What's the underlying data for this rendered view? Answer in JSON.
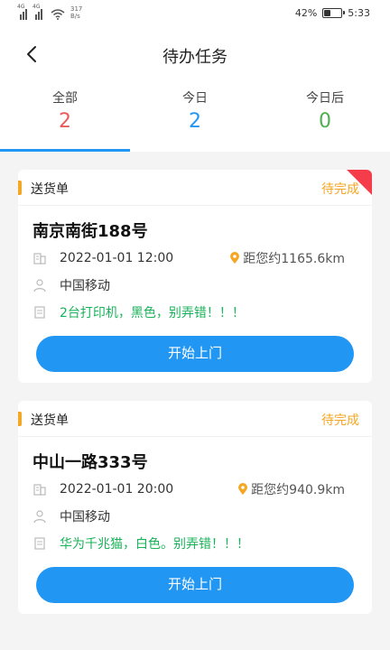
{
  "status_bar": {
    "sim1_tag": "4G",
    "sim2_tag": "4G",
    "speed_value": "317",
    "speed_unit": "B/s",
    "battery_percent": "42%",
    "battery_level": 0.42,
    "time": "5:33"
  },
  "header": {
    "title": "待办任务",
    "back_icon": "chevron-left-icon"
  },
  "tabs": [
    {
      "label": "全部",
      "count": "2",
      "color": "#E95B5B",
      "active": true
    },
    {
      "label": "今日",
      "count": "2",
      "color": "#2196F3",
      "active": false
    },
    {
      "label": "今日后",
      "count": "0",
      "color": "#4CAF50",
      "active": false
    }
  ],
  "colors": {
    "primary": "#2196F3",
    "status_pending": "#F5A623",
    "note_green": "#19B35A",
    "badge_red": "#F53C4B"
  },
  "cards": [
    {
      "type": "送货单",
      "status": "待完成",
      "address": "南京南街188号",
      "datetime": "2022-01-01 12:00",
      "distance": "距您约1165.6km",
      "company": "中国移动",
      "note": "2台打印机，黑色，别弄错！！！",
      "button": "开始上门",
      "has_corner_badge": true
    },
    {
      "type": "送货单",
      "status": "待完成",
      "address": "中山一路333号",
      "datetime": "2022-01-01 20:00",
      "distance": "距您约940.9km",
      "company": "中国移动",
      "note": "华为千兆猫，白色。别弄错！！！",
      "button": "开始上门",
      "has_corner_badge": false
    }
  ]
}
